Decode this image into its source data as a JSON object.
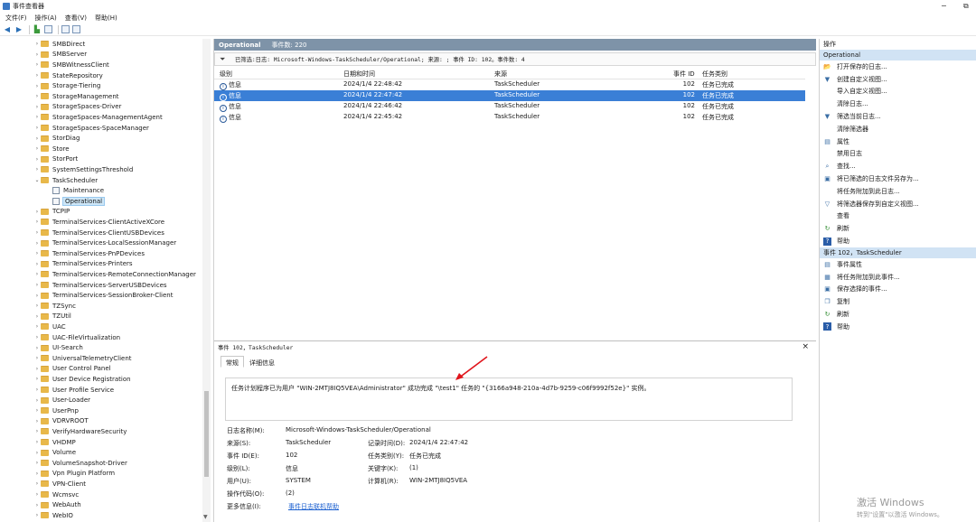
{
  "window": {
    "title": "事件查看器",
    "minimize": "−",
    "restore": "⧉"
  },
  "menu": [
    "文件(F)",
    "操作(A)",
    "查看(V)",
    "帮助(H)"
  ],
  "tree": {
    "items": [
      {
        "label": "SMBDirect",
        "type": "folder",
        "chev": "›"
      },
      {
        "label": "SMBServer",
        "type": "folder",
        "chev": "›"
      },
      {
        "label": "SMBWitnessClient",
        "type": "folder",
        "chev": "›"
      },
      {
        "label": "StateRepository",
        "type": "folder",
        "chev": "›"
      },
      {
        "label": "Storage-Tiering",
        "type": "folder",
        "chev": "›"
      },
      {
        "label": "StorageManagement",
        "type": "folder",
        "chev": "›"
      },
      {
        "label": "StorageSpaces-Driver",
        "type": "folder",
        "chev": "›"
      },
      {
        "label": "StorageSpaces-ManagementAgent",
        "type": "folder",
        "chev": "›"
      },
      {
        "label": "StorageSpaces-SpaceManager",
        "type": "folder",
        "chev": "›"
      },
      {
        "label": "StorDiag",
        "type": "folder",
        "chev": "›"
      },
      {
        "label": "Store",
        "type": "folder",
        "chev": "›"
      },
      {
        "label": "StorPort",
        "type": "folder",
        "chev": "›"
      },
      {
        "label": "SystemSettingsThreshold",
        "type": "folder",
        "chev": "›"
      },
      {
        "label": "TaskScheduler",
        "type": "folder",
        "chev": "⌄"
      },
      {
        "label": "Maintenance",
        "type": "log",
        "chev": ""
      },
      {
        "label": "Operational",
        "type": "log",
        "chev": "",
        "selected": true
      },
      {
        "label": "TCPIP",
        "type": "folder",
        "chev": "›"
      },
      {
        "label": "TerminalServices-ClientActiveXCore",
        "type": "folder",
        "chev": "›"
      },
      {
        "label": "TerminalServices-ClientUSBDevices",
        "type": "folder",
        "chev": "›"
      },
      {
        "label": "TerminalServices-LocalSessionManager",
        "type": "folder",
        "chev": "›"
      },
      {
        "label": "TerminalServices-PnPDevices",
        "type": "folder",
        "chev": "›"
      },
      {
        "label": "TerminalServices-Printers",
        "type": "folder",
        "chev": "›"
      },
      {
        "label": "TerminalServices-RemoteConnectionManager",
        "type": "folder",
        "chev": "›"
      },
      {
        "label": "TerminalServices-ServerUSBDevices",
        "type": "folder",
        "chev": "›"
      },
      {
        "label": "TerminalServices-SessionBroker-Client",
        "type": "folder",
        "chev": "›"
      },
      {
        "label": "TZSync",
        "type": "folder",
        "chev": "›"
      },
      {
        "label": "TZUtil",
        "type": "folder",
        "chev": "›"
      },
      {
        "label": "UAC",
        "type": "folder",
        "chev": "›"
      },
      {
        "label": "UAC-FileVirtualization",
        "type": "folder",
        "chev": "›"
      },
      {
        "label": "UI-Search",
        "type": "folder",
        "chev": "›"
      },
      {
        "label": "UniversalTelemetryClient",
        "type": "folder",
        "chev": "›"
      },
      {
        "label": "User Control Panel",
        "type": "folder",
        "chev": "›"
      },
      {
        "label": "User Device Registration",
        "type": "folder",
        "chev": "›"
      },
      {
        "label": "User Profile Service",
        "type": "folder",
        "chev": "›"
      },
      {
        "label": "User-Loader",
        "type": "folder",
        "chev": "›"
      },
      {
        "label": "UserPnp",
        "type": "folder",
        "chev": "›"
      },
      {
        "label": "VDRVROOT",
        "type": "folder",
        "chev": "›"
      },
      {
        "label": "VerifyHardwareSecurity",
        "type": "folder",
        "chev": "›"
      },
      {
        "label": "VHDMP",
        "type": "folder",
        "chev": "›"
      },
      {
        "label": "Volume",
        "type": "folder",
        "chev": "›"
      },
      {
        "label": "VolumeSnapshot-Driver",
        "type": "folder",
        "chev": "›"
      },
      {
        "label": "Vpn Plugin Platform",
        "type": "folder",
        "chev": "›"
      },
      {
        "label": "VPN-Client",
        "type": "folder",
        "chev": "›"
      },
      {
        "label": "Wcmsvc",
        "type": "folder",
        "chev": "›"
      },
      {
        "label": "WebAuth",
        "type": "folder",
        "chev": "›"
      },
      {
        "label": "WebIO",
        "type": "folder",
        "chev": "›"
      }
    ]
  },
  "center": {
    "header_title": "Operational",
    "header_count": "事件数: 220",
    "filter_text": "已筛选:日志: Microsoft-Windows-TaskScheduler/Operational; 来源: ; 事件 ID: 102。事件数: 4",
    "columns": [
      "级别",
      "日期和时间",
      "来源",
      "事件 ID",
      "任务类别"
    ],
    "rows": [
      {
        "level": "信息",
        "datetime": "2024/1/4 22:48:42",
        "source": "TaskScheduler",
        "event_id": "102",
        "category": "任务已完成"
      },
      {
        "level": "信息",
        "datetime": "2024/1/4 22:47:42",
        "source": "TaskScheduler",
        "event_id": "102",
        "category": "任务已完成",
        "selected": true
      },
      {
        "level": "信息",
        "datetime": "2024/1/4 22:46:42",
        "source": "TaskScheduler",
        "event_id": "102",
        "category": "任务已完成"
      },
      {
        "level": "信息",
        "datetime": "2024/1/4 22:45:42",
        "source": "TaskScheduler",
        "event_id": "102",
        "category": "任务已完成"
      }
    ]
  },
  "detail": {
    "title": "事件 102，TaskScheduler",
    "close": "×",
    "tabs": [
      "常规",
      "详细信息"
    ],
    "message": "任务计划程序已为用户 \"WIN-2MTJ8IQ5VEA\\Administrator\" 成功完成 \"\\test1\" 任务的 \"{3166a948-210a-4d7b-9259-c06f9992f52e}\" 实例。",
    "props": {
      "log_name_label": "日志名称(M):",
      "log_name": "Microsoft-Windows-TaskScheduler/Operational",
      "source_label": "来源(S):",
      "source": "TaskScheduler",
      "logged_label": "记录时间(D):",
      "logged": "2024/1/4 22:47:42",
      "event_id_label": "事件 ID(E):",
      "event_id": "102",
      "category_label": "任务类别(Y):",
      "category": "任务已完成",
      "level_label": "级别(L):",
      "level": "信息",
      "keywords_label": "关键字(K):",
      "keywords": "(1)",
      "user_label": "用户(U):",
      "user": "SYSTEM",
      "computer_label": "计算机(R):",
      "computer": "WIN-2MTJ8IQ5VEA",
      "opcode_label": "操作代码(O):",
      "opcode": "(2)",
      "more_label": "更多信息(I):",
      "more_link": "事件日志联机帮助"
    }
  },
  "actions": {
    "title": "操作",
    "section1": "Operational",
    "items1": [
      {
        "label": "打开保存的日志...",
        "icon": "folder-open-icon",
        "glyph": "📂"
      },
      {
        "label": "创建自定义视图...",
        "icon": "filter-icon",
        "glyph": "▼"
      },
      {
        "label": "导入自定义视图...",
        "icon": "",
        "glyph": ""
      },
      {
        "label": "清除日志...",
        "icon": "",
        "glyph": ""
      },
      {
        "label": "筛选当前日志...",
        "icon": "filter-icon",
        "glyph": "▼"
      },
      {
        "label": "清除筛选器",
        "icon": "",
        "glyph": ""
      },
      {
        "label": "属性",
        "icon": "properties-icon",
        "glyph": "▤"
      },
      {
        "label": "禁用日志",
        "icon": "",
        "glyph": ""
      },
      {
        "label": "查找...",
        "icon": "find-icon",
        "glyph": "⌕"
      },
      {
        "label": "将已筛选的日志文件另存为...",
        "icon": "save-icon",
        "glyph": "▣"
      },
      {
        "label": "将任务附加到此日志...",
        "icon": "",
        "glyph": ""
      },
      {
        "label": "将筛选器保存到自定义视图...",
        "icon": "filter-save-icon",
        "glyph": "▽"
      },
      {
        "label": "查看",
        "icon": "",
        "glyph": ""
      },
      {
        "label": "刷新",
        "icon": "refresh-icon",
        "glyph": "↻"
      },
      {
        "label": "帮助",
        "icon": "help-icon",
        "glyph": "?"
      }
    ],
    "section2": "事件 102，TaskScheduler",
    "items2": [
      {
        "label": "事件属性",
        "icon": "event-properties-icon",
        "glyph": "▤"
      },
      {
        "label": "将任务附加到此事件...",
        "icon": "attach-task-icon",
        "glyph": "▦"
      },
      {
        "label": "保存选择的事件...",
        "icon": "save-icon",
        "glyph": "▣"
      },
      {
        "label": "复制",
        "icon": "copy-icon",
        "glyph": "❐"
      },
      {
        "label": "刷新",
        "icon": "refresh-icon",
        "glyph": "↻"
      },
      {
        "label": "帮助",
        "icon": "help-icon",
        "glyph": "?"
      }
    ]
  },
  "watermark": {
    "line1": "激活 Windows",
    "line2": "转到\"设置\"以激活 Windows。"
  },
  "colors": {
    "header": "#7e93a8",
    "selection": "#3a7fd6",
    "section": "#d1e3f4",
    "folder": "#e8b84a",
    "annotation_arrow": "#e0141b"
  }
}
